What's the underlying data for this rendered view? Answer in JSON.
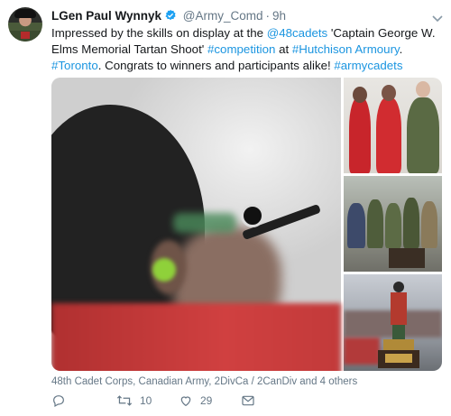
{
  "tweet": {
    "author_name": "LGen Paul Wynnyk",
    "handle": "@Army_Comd",
    "separator": "·",
    "time": "9h",
    "text_segments": [
      {
        "text": "Impressed by the skills on display at the ",
        "link": false
      },
      {
        "text": "@48cadets",
        "link": true
      },
      {
        "text": " 'Captain George W. Elms Memorial Tartan Shoot' ",
        "link": false
      },
      {
        "text": "#competition",
        "link": true
      },
      {
        "text": " at ",
        "link": false
      },
      {
        "text": "#Hutchison",
        "link": true
      },
      {
        "text": " ",
        "link": false
      },
      {
        "text": "Armoury",
        "link": true
      },
      {
        "text": ". ",
        "link": false
      },
      {
        "text": "#Toronto",
        "link": true
      },
      {
        "text": ". Congrats to winners and participants alike! ",
        "link": false
      },
      {
        "text": "#armycadets",
        "link": true
      }
    ],
    "tagged_users": "48th Cadet Corps, Canadian Army, 2DivCa / 2CanDiv and 4 others",
    "actions": {
      "reply_count": "",
      "retweet_count": "10",
      "like_count": "29"
    },
    "icons": [
      "verified-badge-icon",
      "chevron-down-icon",
      "reply-icon",
      "retweet-icon",
      "like-icon",
      "direct-message-icon"
    ],
    "colors": {
      "link": "#1b95e0",
      "secondary_text": "#657786",
      "verified": "#1da1f2"
    }
  }
}
